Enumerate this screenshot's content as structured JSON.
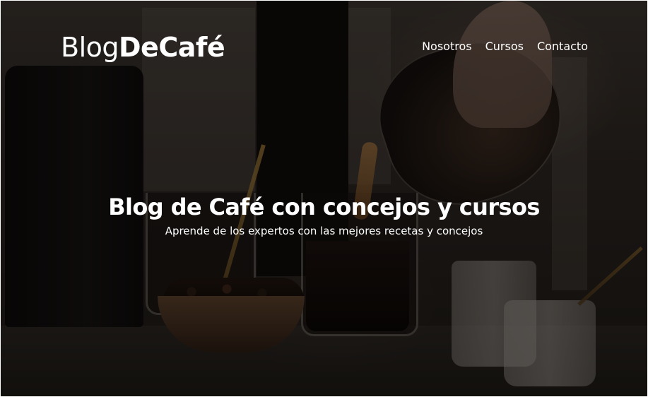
{
  "brand": {
    "logo_light": "Blog",
    "logo_bold": "DeCafé"
  },
  "nav": {
    "items": [
      {
        "label": "Nosotros"
      },
      {
        "label": "Cursos"
      },
      {
        "label": "Contacto"
      }
    ]
  },
  "hero": {
    "title": "Blog de Café con concejos y cursos",
    "subtitle": "Aprende de los expertos con las mejores recetas y concejos",
    "background_image": "coffee-pouring-scene"
  },
  "colors": {
    "text": "#ffffff",
    "overlay": "#000000"
  }
}
